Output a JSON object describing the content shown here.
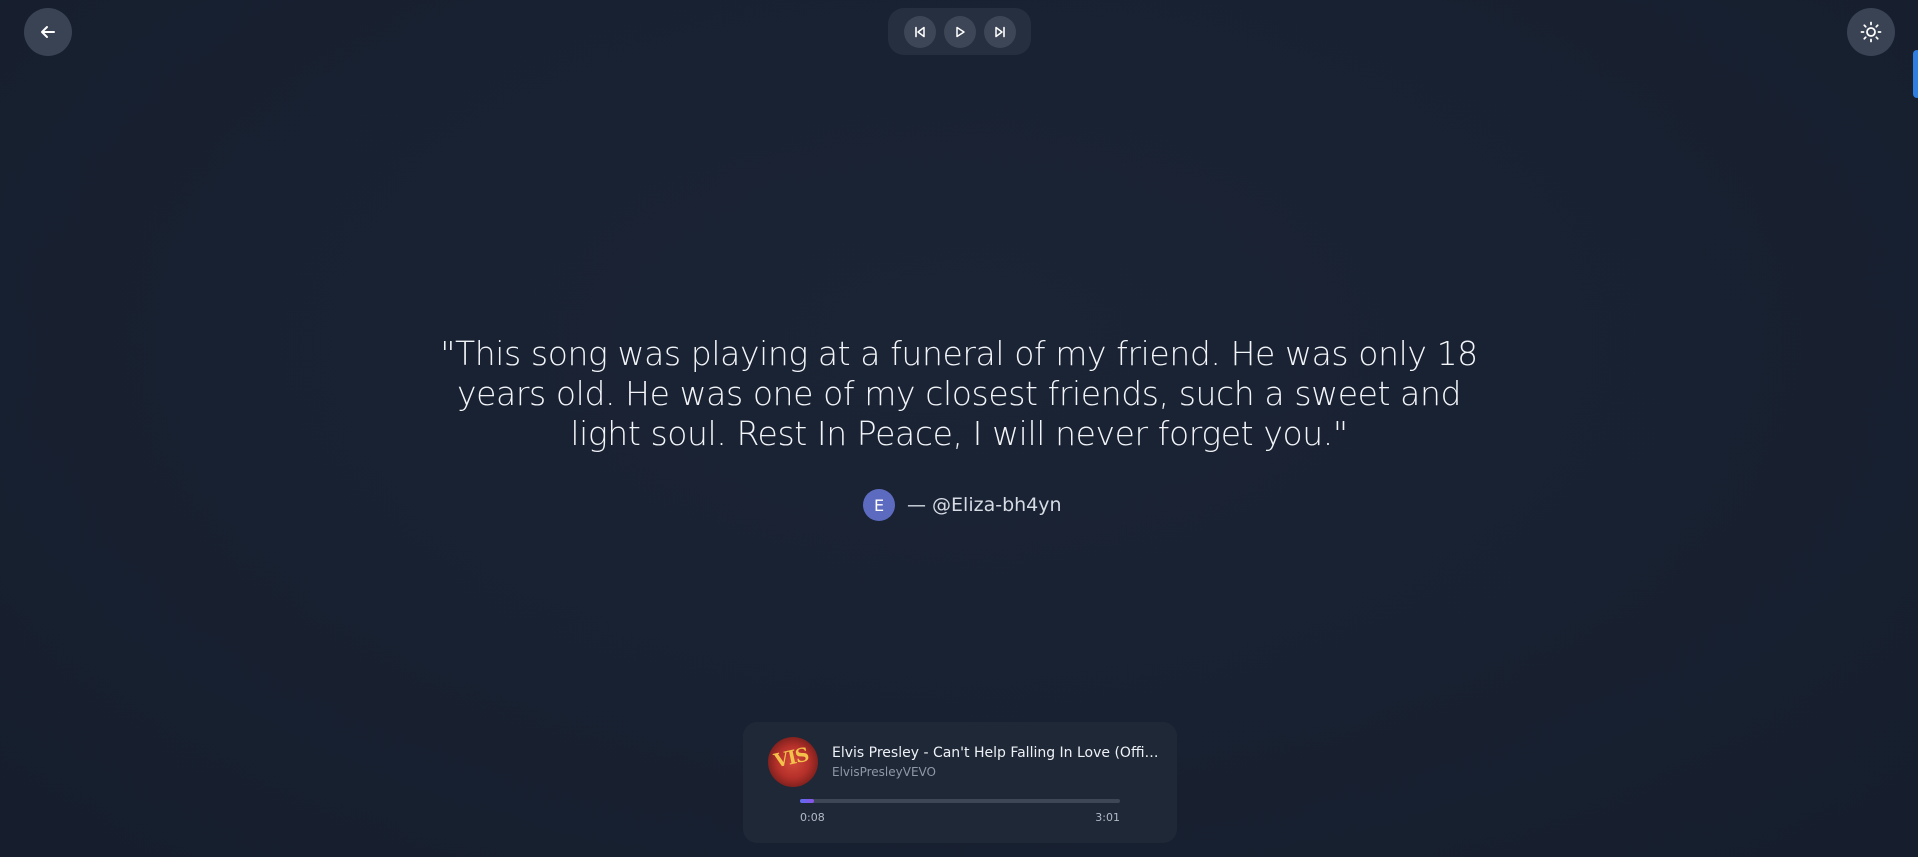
{
  "header": {
    "back_icon": "arrow-left-icon",
    "theme_icon": "sun-icon",
    "controls": {
      "previous_icon": "skip-previous-icon",
      "play_icon": "play-icon",
      "next_icon": "skip-next-icon"
    }
  },
  "comment": {
    "text": "\"This song was playing at a funeral of my friend. He was only 18 years old. He was one of my closest friends, such a sweet and light soul. Rest In Peace, I will never forget you.\"",
    "author_initial": "E",
    "author": "— @Eliza-bh4yn",
    "avatar_color": "#5c6bc0"
  },
  "player": {
    "title": "Elvis Presley - Can't Help Falling In Love (Official...",
    "channel": "ElvisPresleyVEVO",
    "current_time": "0:08",
    "duration": "3:01",
    "progress_fraction": 0.044,
    "thumbnail_text": "VIS"
  },
  "colors": {
    "background": "#182131",
    "accent": "#2f7de1",
    "progress": "#6a5ff0"
  }
}
